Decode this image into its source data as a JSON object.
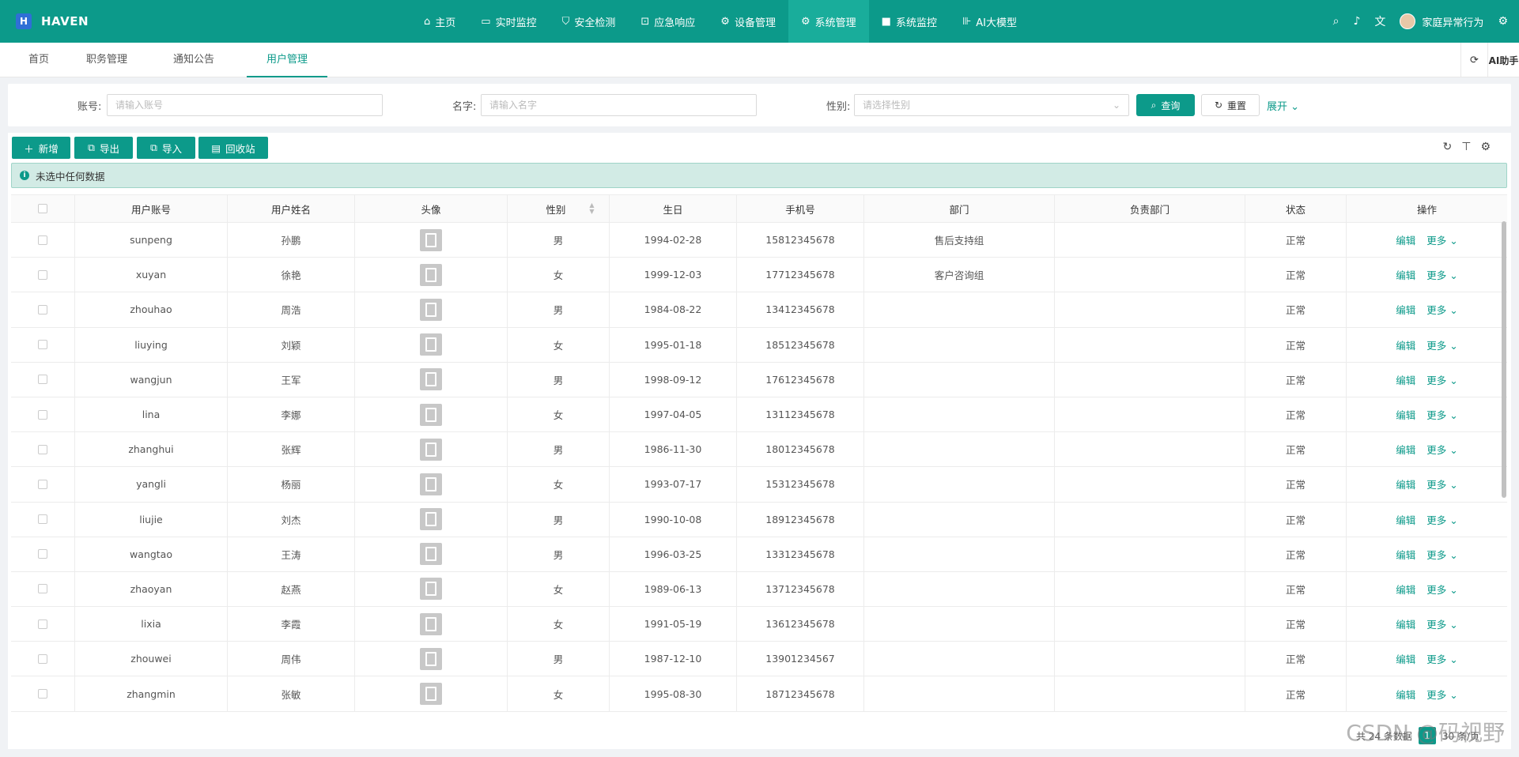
{
  "brand": {
    "logo_letter": "H",
    "name": "HAVEN"
  },
  "nav": [
    {
      "label": "主页",
      "icon": "home-icon",
      "glyph": "⌂"
    },
    {
      "label": "实时监控",
      "icon": "camera-icon",
      "glyph": "▭"
    },
    {
      "label": "安全检测",
      "icon": "shield-icon",
      "glyph": "⛉"
    },
    {
      "label": "应急响应",
      "icon": "lock-icon",
      "glyph": "⊡"
    },
    {
      "label": "设备管理",
      "icon": "gear-icon",
      "glyph": "⚙"
    },
    {
      "label": "系统管理",
      "icon": "gear-icon",
      "glyph": "⚙",
      "active": true
    },
    {
      "label": "系统监控",
      "icon": "video-icon",
      "glyph": "■"
    },
    {
      "label": "AI大模型",
      "icon": "ai-icon",
      "glyph": "⊪"
    }
  ],
  "topright": {
    "username": "家庭异常行为"
  },
  "tabs": [
    "首页",
    "职务管理",
    "通知公告",
    "用户管理"
  ],
  "tabs_active": "用户管理",
  "tabs_right": {
    "ai_label": "AI助手"
  },
  "filters": {
    "account_label": "账号:",
    "account_placeholder": "请输入账号",
    "name_label": "名字:",
    "name_placeholder": "请输入名字",
    "gender_label": "性别:",
    "gender_placeholder": "请选择性别",
    "query_label": "查询",
    "reset_label": "重置",
    "expand_label": "展开"
  },
  "toolbar": {
    "add_label": "新增",
    "export_label": "导出",
    "import_label": "导入",
    "recycle_label": "回收站"
  },
  "alert_text": "未选中任何数据",
  "columns": [
    "用户账号",
    "用户姓名",
    "头像",
    "性别",
    "生日",
    "手机号",
    "部门",
    "负责部门",
    "状态",
    "操作"
  ],
  "rows": [
    {
      "account": "sunpeng",
      "name": "孙鹏",
      "gender": "男",
      "birthday": "1994-02-28",
      "phone": "15812345678",
      "dept": "售后支持组",
      "lead_dept": "",
      "status": "正常"
    },
    {
      "account": "xuyan",
      "name": "徐艳",
      "gender": "女",
      "birthday": "1999-12-03",
      "phone": "17712345678",
      "dept": "客户咨询组",
      "lead_dept": "",
      "status": "正常"
    },
    {
      "account": "zhouhao",
      "name": "周浩",
      "gender": "男",
      "birthday": "1984-08-22",
      "phone": "13412345678",
      "dept": "",
      "lead_dept": "",
      "status": "正常"
    },
    {
      "account": "liuying",
      "name": "刘颖",
      "gender": "女",
      "birthday": "1995-01-18",
      "phone": "18512345678",
      "dept": "",
      "lead_dept": "",
      "status": "正常"
    },
    {
      "account": "wangjun",
      "name": "王军",
      "gender": "男",
      "birthday": "1998-09-12",
      "phone": "17612345678",
      "dept": "",
      "lead_dept": "",
      "status": "正常"
    },
    {
      "account": "lina",
      "name": "李娜",
      "gender": "女",
      "birthday": "1997-04-05",
      "phone": "13112345678",
      "dept": "",
      "lead_dept": "",
      "status": "正常"
    },
    {
      "account": "zhanghui",
      "name": "张辉",
      "gender": "男",
      "birthday": "1986-11-30",
      "phone": "18012345678",
      "dept": "",
      "lead_dept": "",
      "status": "正常"
    },
    {
      "account": "yangli",
      "name": "杨丽",
      "gender": "女",
      "birthday": "1993-07-17",
      "phone": "15312345678",
      "dept": "",
      "lead_dept": "",
      "status": "正常"
    },
    {
      "account": "liujie",
      "name": "刘杰",
      "gender": "男",
      "birthday": "1990-10-08",
      "phone": "18912345678",
      "dept": "",
      "lead_dept": "",
      "status": "正常"
    },
    {
      "account": "wangtao",
      "name": "王涛",
      "gender": "男",
      "birthday": "1996-03-25",
      "phone": "13312345678",
      "dept": "",
      "lead_dept": "",
      "status": "正常"
    },
    {
      "account": "zhaoyan",
      "name": "赵燕",
      "gender": "女",
      "birthday": "1989-06-13",
      "phone": "13712345678",
      "dept": "",
      "lead_dept": "",
      "status": "正常"
    },
    {
      "account": "lixia",
      "name": "李霞",
      "gender": "女",
      "birthday": "1991-05-19",
      "phone": "13612345678",
      "dept": "",
      "lead_dept": "",
      "status": "正常"
    },
    {
      "account": "zhouwei",
      "name": "周伟",
      "gender": "男",
      "birthday": "1987-12-10",
      "phone": "13901234567",
      "dept": "",
      "lead_dept": "",
      "status": "正常"
    },
    {
      "account": "zhangmin",
      "name": "张敏",
      "gender": "女",
      "birthday": "1995-08-30",
      "phone": "18712345678",
      "dept": "",
      "lead_dept": "",
      "status": "正常"
    }
  ],
  "row_actions": {
    "edit": "编辑",
    "more": "更多"
  },
  "pagination": {
    "total_text": "共 24 条数据",
    "current_page": "1",
    "page_size": "30 条/页"
  },
  "watermark": "CSDN @码视野",
  "colors": {
    "primary": "#0c9a8a",
    "nav_active": "#19ad9b",
    "logo_bg": "#2f6fd6"
  }
}
